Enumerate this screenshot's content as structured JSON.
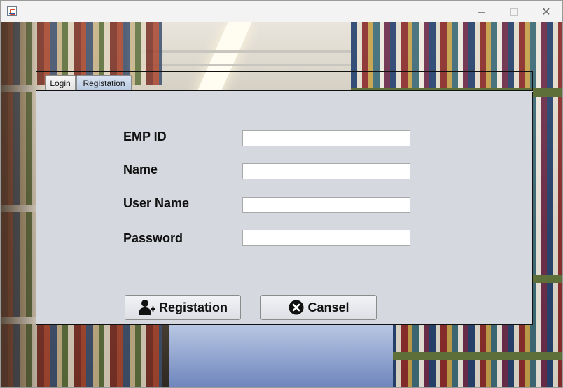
{
  "window": {
    "icon": "java-cup-icon",
    "controls": [
      "minimize-icon",
      "maximize-icon",
      "close-icon"
    ],
    "close_glyph": "✕"
  },
  "tabs": [
    {
      "label": "Login",
      "selected": false
    },
    {
      "label": "Registation",
      "selected": true
    }
  ],
  "form": {
    "fields": [
      {
        "label": "EMP ID",
        "value": ""
      },
      {
        "label": "Name",
        "value": ""
      },
      {
        "label": "User Name",
        "value": ""
      },
      {
        "label": "Password",
        "value": ""
      }
    ],
    "register_button": {
      "label": "Registation",
      "icon": "add-user-icon"
    },
    "cancel_button": {
      "label": "Cansel",
      "icon": "cancel-circle-icon"
    }
  },
  "colors": {
    "panel_bg": "#d6d8df",
    "selected_tab": "#b8c9e0"
  }
}
